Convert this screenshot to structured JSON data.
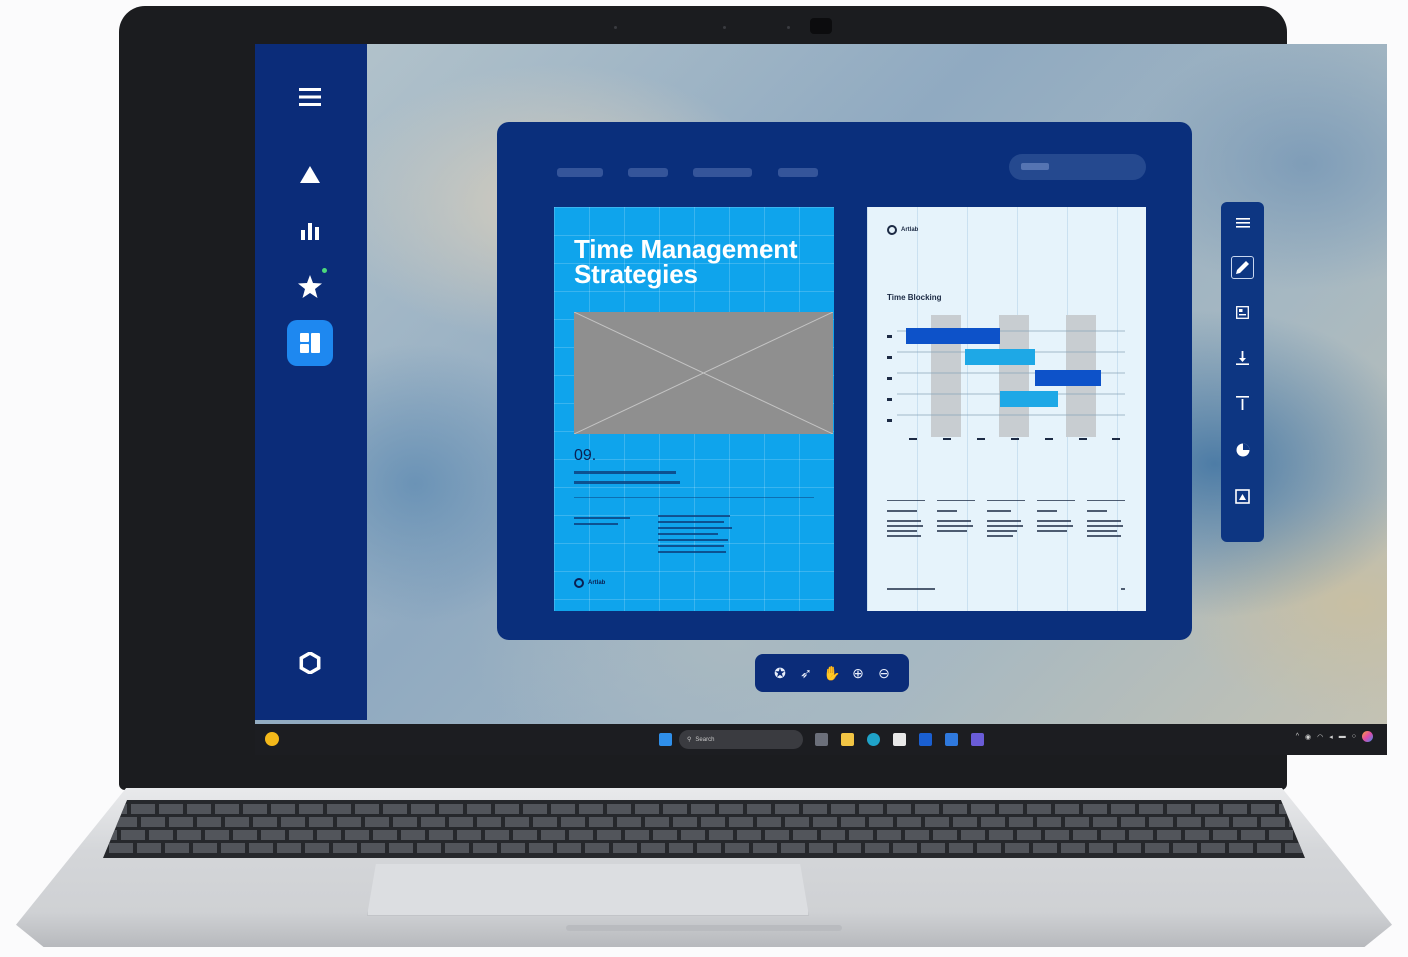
{
  "document_left": {
    "title": "Time Management Strategies",
    "number": "09.",
    "brand_label": "Artlab"
  },
  "document_right": {
    "brand_label": "Artlab",
    "chart_title": "Time Blocking"
  },
  "taskbar": {
    "search_placeholder": "Search"
  },
  "colors": {
    "sidebar": "#0b2c79",
    "window": "#0a2f7c",
    "accent": "#1e88f0",
    "page_left": "#0fa4ec",
    "page_right": "#e6f3fb"
  },
  "icons": {
    "sidebar": [
      "menu-icon",
      "triangle-icon",
      "bar-chart-icon",
      "star-icon",
      "dashboard-icon",
      "settings-icon"
    ],
    "rail": [
      "list-icon",
      "pen-icon",
      "layout-icon",
      "align-bottom-icon",
      "text-top-icon",
      "pie-chart-icon",
      "image-crop-icon"
    ],
    "toolbar": [
      "smart-cursor-icon",
      "pointer-icon",
      "hand-icon",
      "zoom-in-icon",
      "zoom-out-icon"
    ]
  }
}
